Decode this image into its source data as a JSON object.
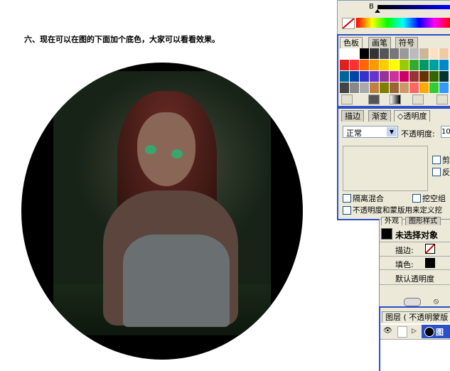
{
  "caption": "六、现在可以在图的下面加个底色，大家可以看看效果。",
  "color_panel": {
    "channel_label": "B",
    "tabs": [
      {
        "label": "色板"
      },
      {
        "label": "画笔"
      },
      {
        "label": "符号"
      }
    ]
  },
  "transparency_panel": {
    "tabs": [
      {
        "label": "描边"
      },
      {
        "label": "渐变"
      },
      {
        "label": "◇透明度"
      }
    ],
    "blend_mode": "正常",
    "opacity_label": "不透明度:",
    "opacity_value": "10",
    "clip_label": "剪",
    "invert_label": "反",
    "isolate_label": "隔离混合",
    "knockout_label": "挖空组",
    "define_label": "不透明度和蒙版用来定义挖"
  },
  "appearance_panel": {
    "tabs": [
      {
        "label": "外观"
      },
      {
        "label": "图形样式"
      }
    ],
    "title": "未选择对象",
    "stroke_label": "描边:",
    "fill_label": "填色:",
    "default_label": "默认透明度"
  },
  "layers_panel": {
    "title": "图层 ( 不透明蒙版",
    "layer_name": "图层"
  },
  "colors": {
    "accent": "#2b50c7",
    "panel_bg": "#ece9d8",
    "art_bg": "#000000"
  }
}
